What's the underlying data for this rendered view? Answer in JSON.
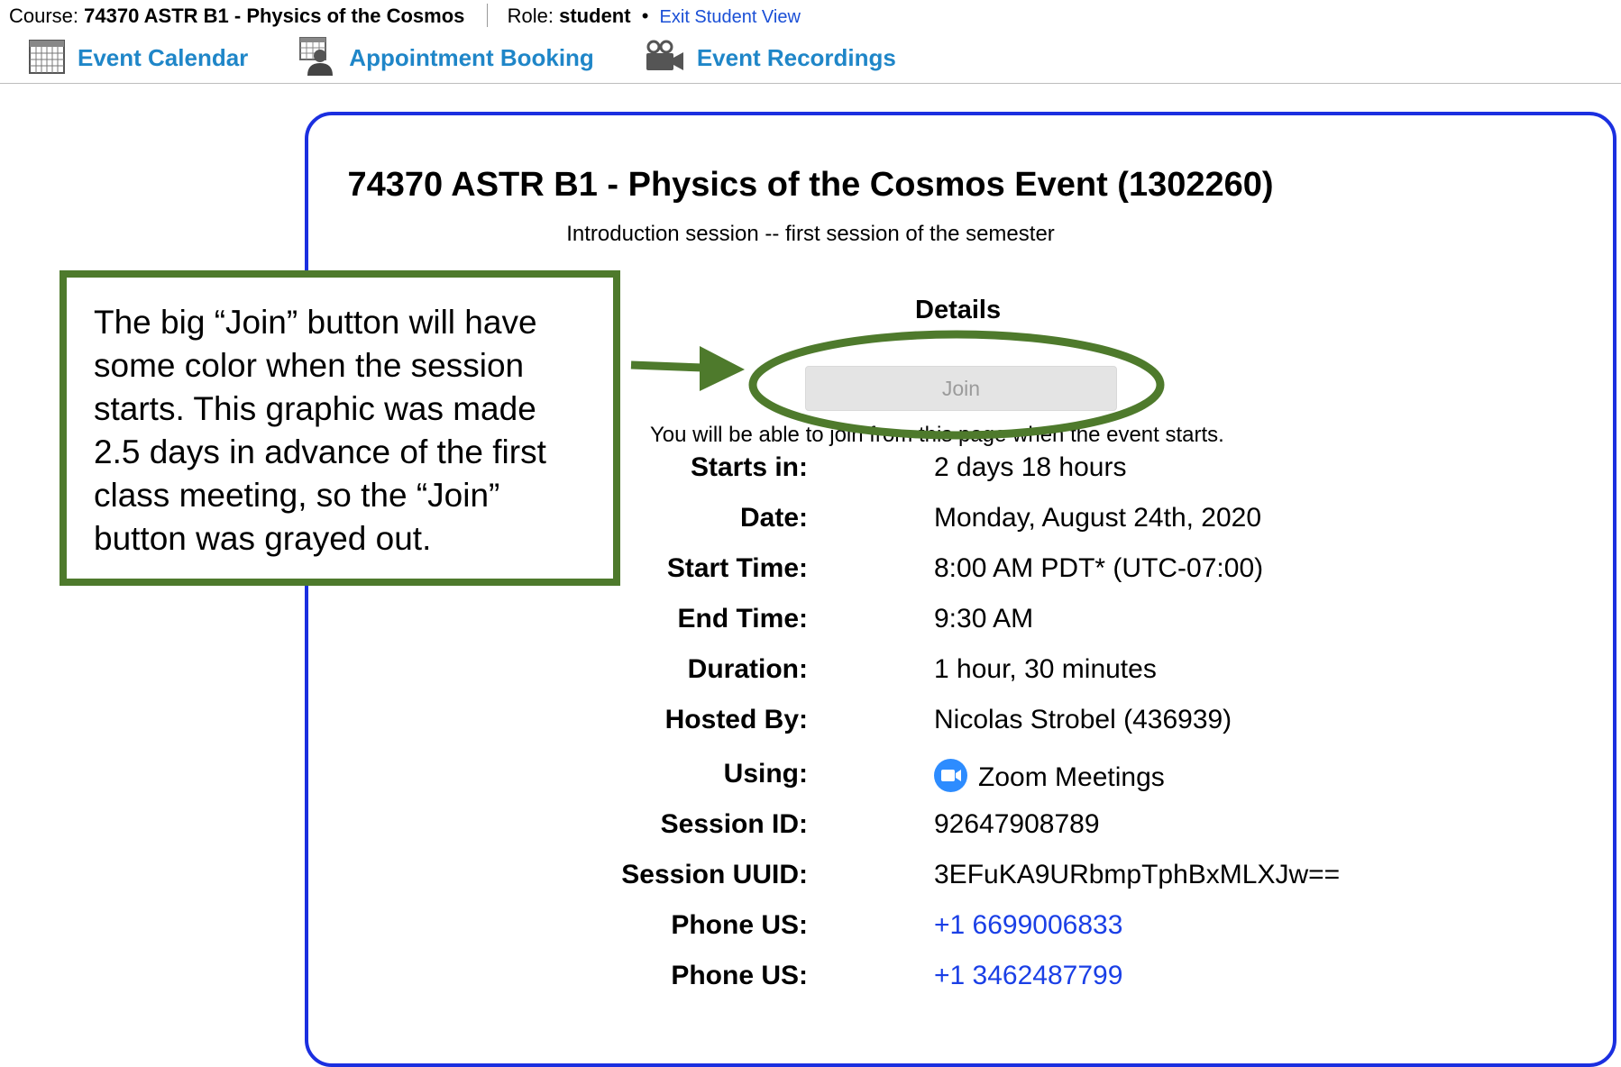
{
  "course_bar": {
    "course_label": "Course:",
    "course_name": "74370 ASTR B1 - Physics of the Cosmos",
    "role_label": "Role:",
    "role_value": "student",
    "separator": "•",
    "exit_link": "Exit Student View"
  },
  "nav": {
    "items": [
      {
        "label": "Event Calendar",
        "icon": "calendar-icon"
      },
      {
        "label": "Appointment Booking",
        "icon": "person-calendar-icon"
      },
      {
        "label": "Event Recordings",
        "icon": "video-camera-icon"
      }
    ]
  },
  "event": {
    "title": "74370 ASTR B1 - Physics of the Cosmos Event (1302260)",
    "subtitle": "Introduction session -- first session of the semester",
    "details_heading": "Details",
    "join_label": "Join",
    "join_note": "You will be able to join from this page when the event starts.",
    "rows": [
      {
        "key": "Starts in:",
        "value": "2 days 18 hours"
      },
      {
        "key": "Date:",
        "value": "Monday, August 24th, 2020"
      },
      {
        "key": "Start Time:",
        "value": "8:00 AM PDT* (UTC-07:00)"
      },
      {
        "key": "End Time:",
        "value": "9:30 AM"
      },
      {
        "key": "Duration:",
        "value": "1 hour, 30 minutes"
      },
      {
        "key": "Hosted By:",
        "value": "Nicolas Strobel (436939)"
      },
      {
        "key": "Using:",
        "value": "Zoom Meetings",
        "icon": "zoom-icon"
      },
      {
        "key": "Session ID:",
        "value": "92647908789"
      },
      {
        "key": "Session UUID:",
        "value": "3EFuKA9URbmpTphBxMLXJw=="
      },
      {
        "key": "Phone US:",
        "value": "+1 6699006833",
        "link": true
      },
      {
        "key": "Phone US:",
        "value": "+1 3462487799",
        "link": true
      }
    ]
  },
  "callout": {
    "text": "The big “Join” button will have some color when the session starts. This graphic was made 2.5 days in advance of the first class meeting, so the “Join” button was grayed out."
  },
  "colors": {
    "panel_border": "#1b2fe0",
    "nav_link": "#1f86c8",
    "callout_green": "#4e7a2c",
    "phone_link": "#1a3fe6",
    "zoom_blue": "#2d8cff"
  }
}
